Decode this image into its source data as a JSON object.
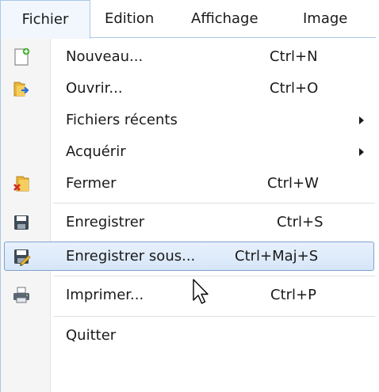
{
  "menubar": {
    "items": [
      {
        "label": "Fichier"
      },
      {
        "label": "Edition"
      },
      {
        "label": "Affichage"
      },
      {
        "label": "Image"
      }
    ]
  },
  "menu": {
    "items": [
      {
        "label": "Nouveau...",
        "shortcut": "Ctrl+N",
        "icon": "new-document-icon"
      },
      {
        "label": "Ouvrir...",
        "shortcut": "Ctrl+O",
        "icon": "open-folder-icon"
      },
      {
        "label": "Fichiers récents",
        "submenu": true
      },
      {
        "label": "Acquérir",
        "submenu": true
      },
      {
        "label": "Fermer",
        "shortcut": "Ctrl+W",
        "icon": "close-folder-icon"
      },
      {
        "label": "Enregistrer",
        "shortcut": "Ctrl+S",
        "icon": "save-disk-icon"
      },
      {
        "label": "Enregistrer sous...",
        "shortcut": "Ctrl+Maj+S",
        "icon": "save-as-disk-icon",
        "highlighted": true
      },
      {
        "label": "Imprimer...",
        "shortcut": "Ctrl+P",
        "icon": "printer-icon"
      },
      {
        "label": "Quitter"
      }
    ]
  },
  "colors": {
    "highlight_border": "#7da2ce",
    "highlight_fill": "#dce9f8",
    "menu_border": "#a8c8e8"
  }
}
